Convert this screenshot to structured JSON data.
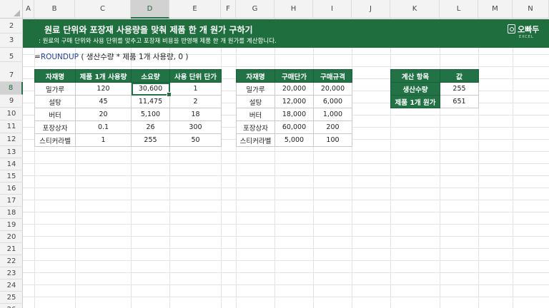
{
  "columns": [
    "A",
    "B",
    "C",
    "D",
    "E",
    "F",
    "G",
    "H",
    "I",
    "J",
    "K",
    "L",
    "M",
    "N"
  ],
  "selected_column": "D",
  "rows": [
    "2",
    "3",
    "5",
    "7",
    "8",
    "9",
    "10",
    "11",
    "12",
    "13",
    "14",
    "15",
    "16",
    "17",
    "18",
    "19",
    "20",
    "21",
    "22",
    "23",
    "24",
    "25",
    "26"
  ],
  "selected_row": "8",
  "banner": {
    "title": "원료 단위와 포장재 사용량을 맞춰 제품 한 개 원가 구하기",
    "subtitle": ": 원료의 구매 단위와 사용 단위를 맞추고 포장재 비용을 반영해 제품 한 개 원가를 계산합니다.",
    "logo_text": "오빠두",
    "logo_sub": "EXCEL"
  },
  "formula": {
    "prefix": "=",
    "function": "ROUNDUP",
    "args": " ( 생산수량 * 제품 1개 사용량, 0 )"
  },
  "table1": {
    "headers": [
      "자재명",
      "제품 1개 사용량",
      "소요량",
      "사용 단위 단가"
    ],
    "rows": [
      [
        "밀가루",
        "120",
        "30,600",
        "1"
      ],
      [
        "설탕",
        "45",
        "11,475",
        "2"
      ],
      [
        "버터",
        "20",
        "5,100",
        "18"
      ],
      [
        "포장상자",
        "0.1",
        "26",
        "300"
      ],
      [
        "스티커라벨",
        "1",
        "255",
        "50"
      ]
    ]
  },
  "table2": {
    "headers": [
      "자재명",
      "구매단가",
      "구매규격"
    ],
    "rows": [
      [
        "밀가루",
        "20,000",
        "20,000"
      ],
      [
        "설탕",
        "12,000",
        "6,000"
      ],
      [
        "버터",
        "18,000",
        "1,000"
      ],
      [
        "포장상자",
        "60,000",
        "200"
      ],
      [
        "스티커라벨",
        "5,000",
        "100"
      ]
    ]
  },
  "table3": {
    "headers": [
      "계산 항목",
      "값"
    ],
    "rows": [
      [
        "생산수량",
        "255"
      ],
      [
        "제품 1개 원가",
        "651"
      ]
    ]
  },
  "colors": {
    "header_green": "#217346",
    "banner_green": "#1f6e3d"
  }
}
